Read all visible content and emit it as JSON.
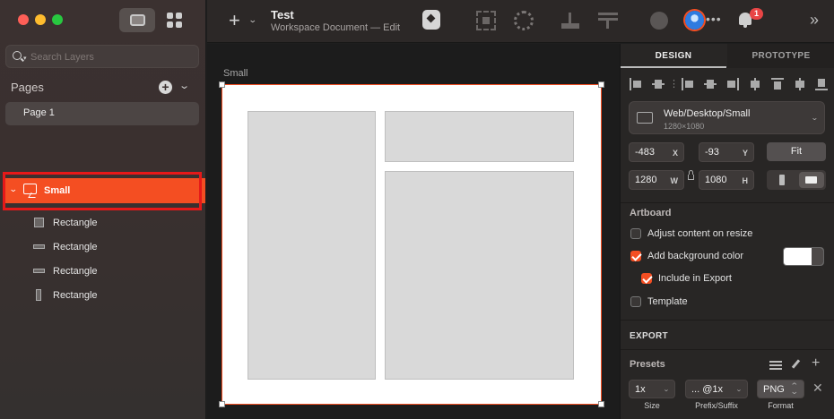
{
  "sidebar": {
    "search": {
      "placeholder": "Search Layers"
    },
    "pages_title": "Pages",
    "pages": [
      {
        "label": "Page 1"
      }
    ],
    "layers": [
      {
        "label": "Small",
        "kind": "artboard",
        "selected": true
      },
      {
        "label": "Rectangle",
        "kind": "rect-square"
      },
      {
        "label": "Rectangle",
        "kind": "rect-wide"
      },
      {
        "label": "Rectangle",
        "kind": "rect-wide"
      },
      {
        "label": "Rectangle",
        "kind": "rect-tall"
      }
    ]
  },
  "toolbar": {
    "doc_title": "Test",
    "doc_subtitle": "Workspace Document — Edit",
    "notification_count": "1"
  },
  "canvas": {
    "artboard_label": "Small"
  },
  "inspector": {
    "tabs": [
      {
        "label": "DESIGN",
        "active": true
      },
      {
        "label": "PROTOTYPE",
        "active": false
      }
    ],
    "preset": {
      "name": "Web/Desktop/Small",
      "size": "1280×1080"
    },
    "x": {
      "value": "-483",
      "unit": "X"
    },
    "y": {
      "value": "-93",
      "unit": "Y"
    },
    "w": {
      "value": "1280",
      "unit": "W"
    },
    "h": {
      "value": "1080",
      "unit": "H"
    },
    "fit_label": "Fit",
    "artboard_title": "Artboard",
    "options": [
      {
        "label": "Adjust content on resize",
        "checked": false
      },
      {
        "label": "Add background color",
        "checked": true
      },
      {
        "label": "Include in Export",
        "checked": true
      },
      {
        "label": "Template",
        "checked": false
      }
    ],
    "background_color": "#FFFFFF",
    "export_title": "EXPORT",
    "presets_title": "Presets",
    "export_row": {
      "size": "1x",
      "suffix": "... @1x",
      "format": "PNG",
      "size_caption": "Size",
      "suffix_caption": "Prefix/Suffix",
      "format_caption": "Format"
    }
  },
  "colors": {
    "accent": "#F44E22",
    "selection_outline": "#E51919"
  }
}
